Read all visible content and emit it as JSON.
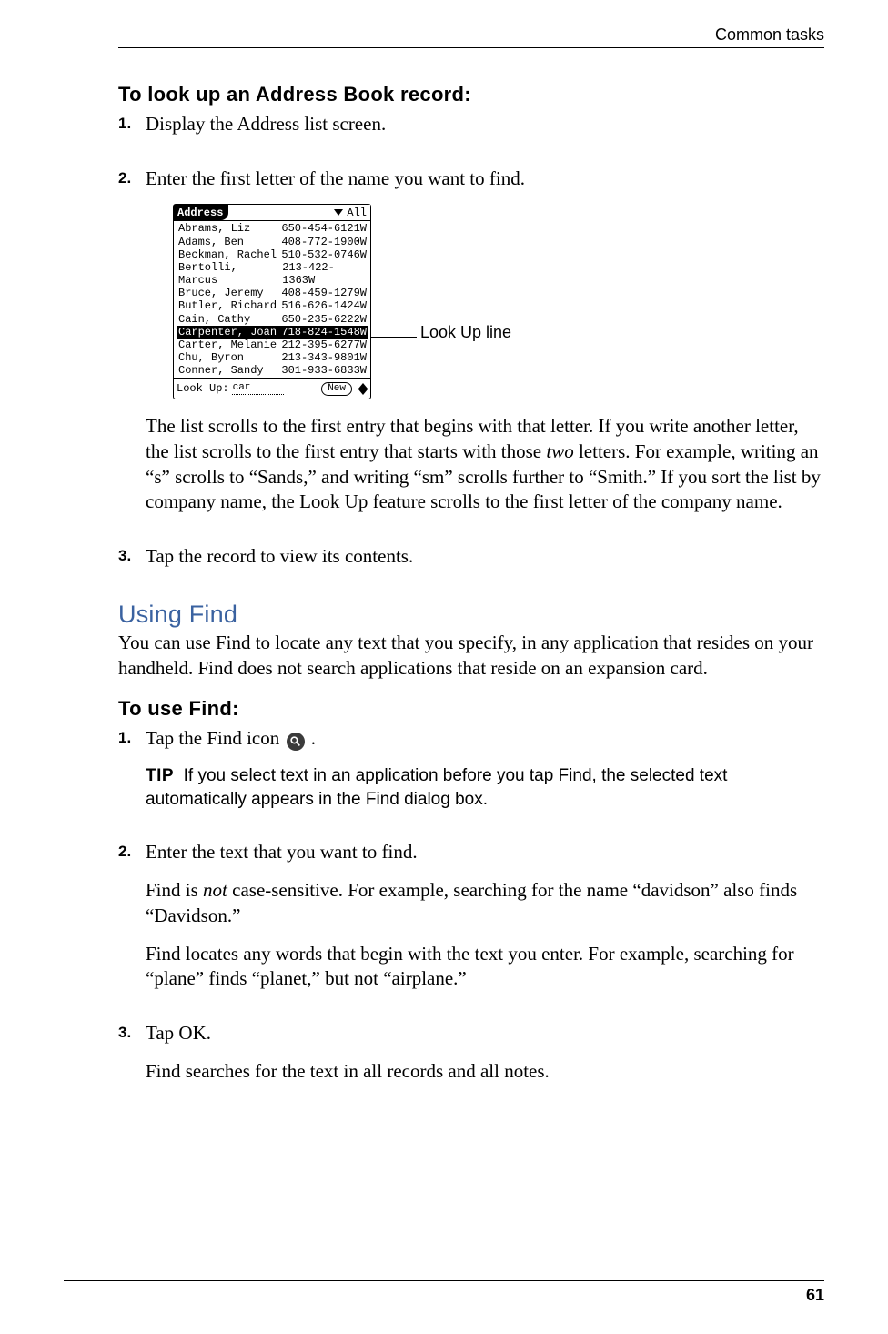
{
  "header": {
    "section": "Common tasks"
  },
  "footer": {
    "page_number": "61"
  },
  "proc1": {
    "title": "To look up an Address Book record:",
    "steps": {
      "s1": {
        "num": "1.",
        "text": "Display the Address list screen."
      },
      "s2": {
        "num": "2.",
        "text": "Enter the first letter of the name you want to find."
      },
      "s2para": {
        "a": "The list scrolls to the first entry that begins with that letter. If you write another letter, the list scrolls to the first entry that starts with those ",
        "em": "two",
        "b": " letters. For example, writing an “s” scrolls to “Sands,” and writing “sm” scrolls further to “Smith.” If you sort the list by company name, the Look Up feature scrolls to the first letter of the company name."
      },
      "s3": {
        "num": "3.",
        "text": "Tap the record to view its contents."
      }
    }
  },
  "screenshot": {
    "title": "Address",
    "category": "All",
    "rows": [
      {
        "name": "Abrams, Liz",
        "phone": "650-454-6121W",
        "sel": false
      },
      {
        "name": "Adams, Ben",
        "phone": "408-772-1900W",
        "sel": false
      },
      {
        "name": "Beckman, Rachel",
        "phone": "510-532-0746W",
        "sel": false
      },
      {
        "name": "Bertolli, Marcus",
        "phone": "213-422-1363W",
        "sel": false
      },
      {
        "name": "Bruce, Jeremy",
        "phone": "408-459-1279W",
        "sel": false
      },
      {
        "name": "Butler, Richard",
        "phone": "516-626-1424W",
        "sel": false
      },
      {
        "name": "Cain, Cathy",
        "phone": "650-235-6222W",
        "sel": false
      },
      {
        "name": "Carpenter, Joan",
        "phone": "718-824-1548W",
        "sel": true
      },
      {
        "name": "Carter, Melanie",
        "phone": "212-395-6277W",
        "sel": false
      },
      {
        "name": "Chu, Byron",
        "phone": "213-343-9801W",
        "sel": false
      },
      {
        "name": "Conner, Sandy",
        "phone": "301-933-6833W",
        "sel": false
      }
    ],
    "lookup_label": "Look Up:",
    "lookup_value": "car",
    "new_button": "New",
    "callout": "Look Up line"
  },
  "sect2": {
    "heading": "Using Find",
    "intro": "You can use Find to locate any text that you specify, in any application that resides on your handheld. Find does not search applications that reside on an expansion card."
  },
  "proc2": {
    "title": "To use Find:",
    "steps": {
      "s1": {
        "num": "1.",
        "pre": "Tap the Find icon ",
        "post": "."
      },
      "tip": {
        "label": "TIP",
        "text": "If you select text in an application before you tap Find, the selected text automatically appears in the Find dialog box."
      },
      "s2": {
        "num": "2.",
        "text": "Enter the text that you want to find."
      },
      "s2p1": {
        "a": "Find is ",
        "em": "not",
        "b": " case-sensitive. For example, searching for the name “davidson” also finds “Davidson.”"
      },
      "s2p2": "Find locates any words that begin with the text you enter. For example, searching for “plane” finds “planet,” but not “airplane.”",
      "s3": {
        "num": "3.",
        "text": "Tap OK."
      },
      "s3p1": "Find searches for the text in all records and all notes."
    }
  }
}
